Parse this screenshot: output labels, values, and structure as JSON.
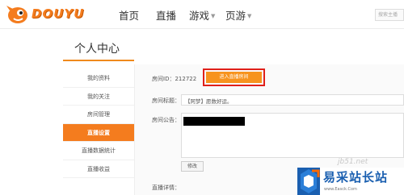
{
  "header": {
    "logo_text": "DOUYU",
    "nav": [
      {
        "label": "首页",
        "caret": ""
      },
      {
        "label": "直播",
        "caret": ""
      },
      {
        "label": "游戏",
        "caret": "▼"
      },
      {
        "label": "页游",
        "caret": "▼"
      }
    ],
    "search_placeholder": "搜索主播"
  },
  "sidebar": {
    "title": "个人中心",
    "items": [
      {
        "label": "我的资料"
      },
      {
        "label": "我的关注"
      },
      {
        "label": "房间管理"
      },
      {
        "label": "直播设置"
      },
      {
        "label": "直播数据统计"
      },
      {
        "label": "直播收益"
      }
    ],
    "active_index": 3
  },
  "settings": {
    "room_id_label": "房间ID：212722",
    "enter_button": "进入直播房间",
    "title_label": "房间标题：",
    "title_value": "【阿梦】愿数好运。",
    "notice_label": "房间公告：",
    "edit_button": "修改",
    "detail_label": "直播详情："
  },
  "watermark": {
    "site_text": "jb51.net",
    "brand": "易采站长站",
    "url": "www.Easck.Com"
  },
  "colors": {
    "accent": "#f47c1e",
    "highlight_border": "#e0201a",
    "brand_blue": "#1a5fb0"
  }
}
